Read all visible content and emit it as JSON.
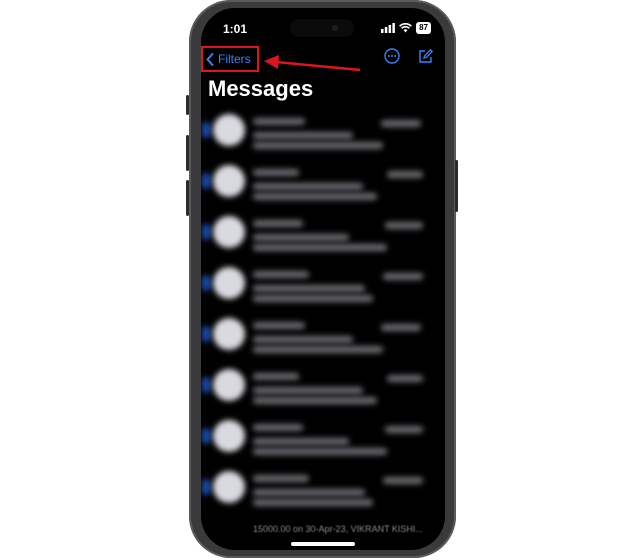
{
  "status_bar": {
    "time": "1:01",
    "battery": "87",
    "icons": [
      "signal-icon",
      "wifi-icon",
      "battery-icon"
    ]
  },
  "nav": {
    "back_label": "Filters",
    "icons": [
      "chevron-left-icon",
      "more-icon",
      "compose-icon"
    ]
  },
  "page": {
    "title": "Messages"
  },
  "messages": {
    "rows": 8
  },
  "partial_row_preview": "15000.00 on 30-Apr-23, VIKRANT KISHI...",
  "colors": {
    "accent": "#3b82f6",
    "annotation": "#e0141e",
    "background": "#000000"
  }
}
